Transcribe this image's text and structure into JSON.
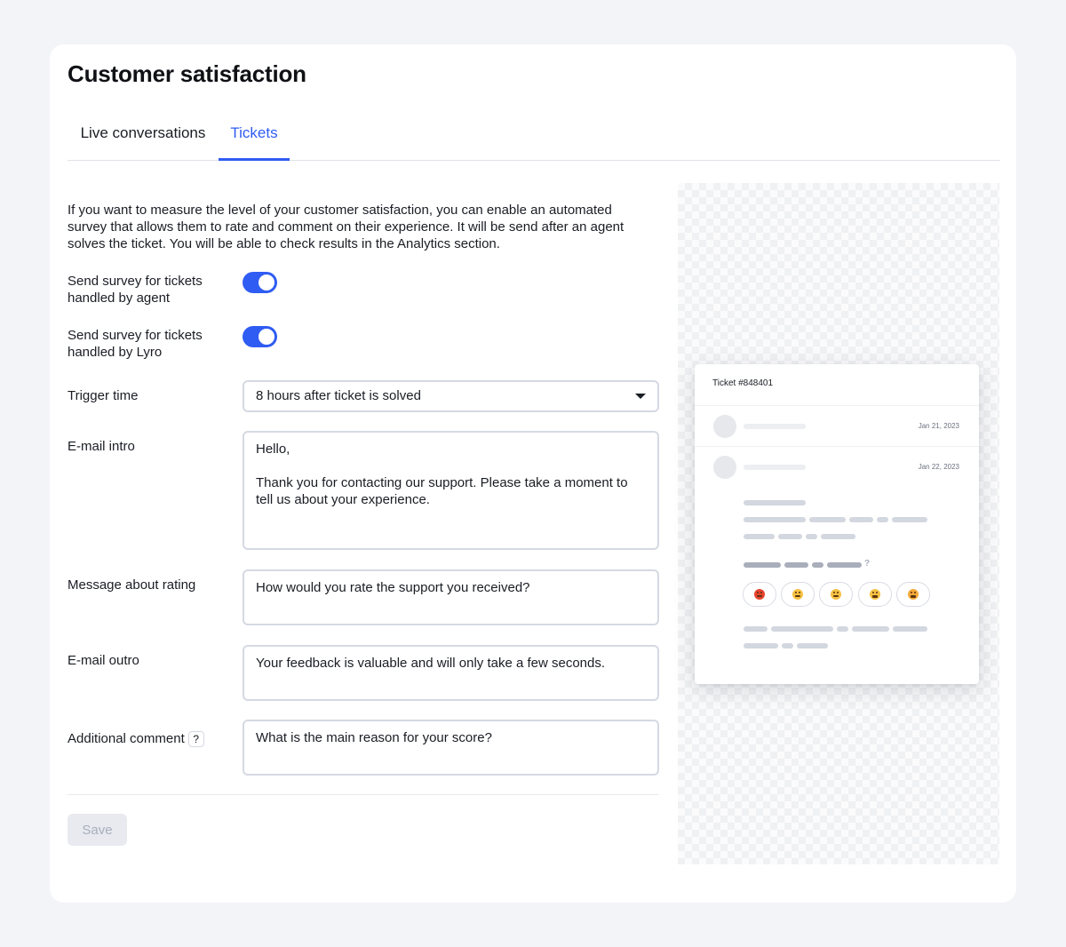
{
  "page": {
    "title": "Customer satisfaction"
  },
  "tabs": [
    {
      "label": "Live conversations",
      "active": false
    },
    {
      "label": "Tickets",
      "active": true
    }
  ],
  "intro_text": "If you want to measure the level of your customer satisfaction, you can enable an automated survey that allows them to rate and comment on their experience. It will be send after an agent solves the ticket. You will be able to check results in the Analytics section.",
  "settings": {
    "survey_agent": {
      "label": "Send survey for tickets handled by agent",
      "enabled": true
    },
    "survey_lyro": {
      "label": "Send survey for tickets handled by Lyro",
      "enabled": true
    },
    "trigger_time": {
      "label": "Trigger time",
      "value": "8 hours after ticket is solved"
    },
    "email_intro": {
      "label": "E-mail intro",
      "value": "Hello,\n\nThank you for contacting our support. Please take a moment to tell us about your experience."
    },
    "rating_message": {
      "label": "Message about rating",
      "value": "How would you rate the support you received?"
    },
    "email_outro": {
      "label": "E-mail outro",
      "value": "Your feedback is valuable and will only take a few seconds."
    },
    "additional_comment": {
      "label": "Additional comment",
      "help": "?",
      "value": "What is the main reason for your score?"
    }
  },
  "save_label": "Save",
  "preview": {
    "ticket_title": "Ticket #848401",
    "messages": [
      {
        "date": "Jan 21, 2023"
      },
      {
        "date": "Jan 22, 2023"
      }
    ],
    "question_mark": "?",
    "rating_emojis": [
      "angry-face",
      "confused-face",
      "neutral-face",
      "grinning-face",
      "heart-eyes-face"
    ]
  },
  "colors": {
    "accent": "#2f5cf2",
    "background": "#f3f4f7",
    "card": "#ffffff",
    "border": "#d5d9e2",
    "disabled_button": "#e8eaf0"
  }
}
